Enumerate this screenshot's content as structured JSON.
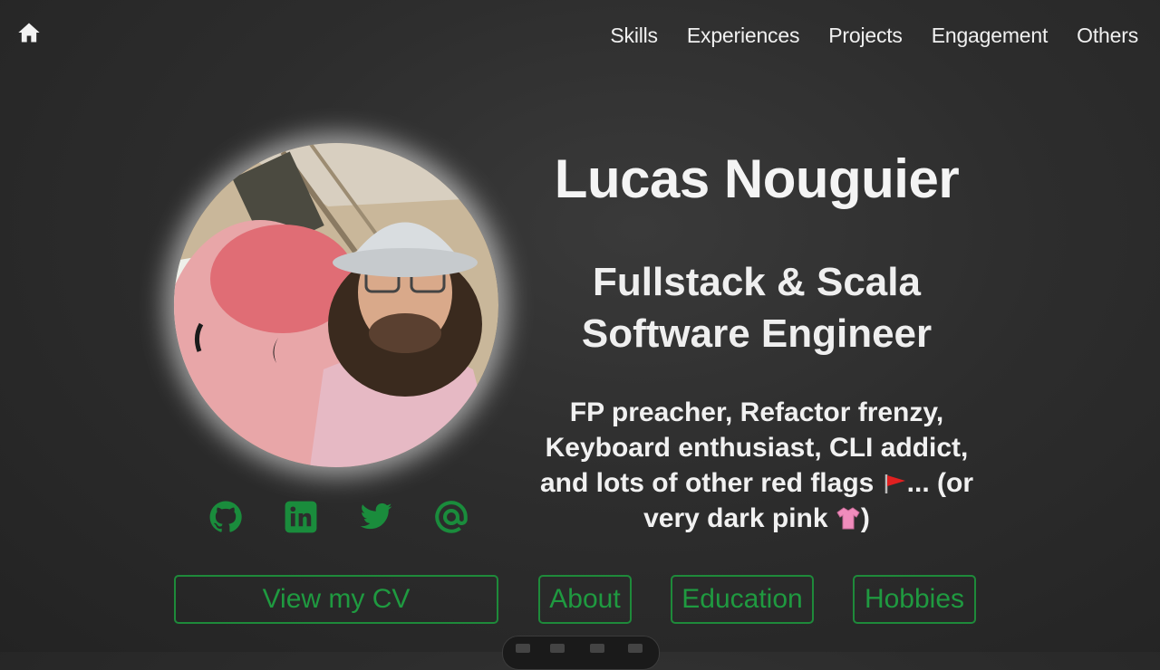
{
  "nav": {
    "home_icon": "home-icon",
    "items": [
      {
        "label": "Skills"
      },
      {
        "label": "Experiences"
      },
      {
        "label": "Projects"
      },
      {
        "label": "Engagement"
      },
      {
        "label": "Others"
      }
    ]
  },
  "profile": {
    "name": "Lucas Nouguier",
    "role_line1": "Fullstack & Scala",
    "role_line2": "Software Engineer",
    "tagline_part1": "FP preacher, Refactor frenzy, Keyboard enthusiast, CLI addict, and lots of other red flags ",
    "tagline_part2": "... (or very dark pink ",
    "tagline_part3": ")"
  },
  "socials": [
    {
      "icon": "github-icon"
    },
    {
      "icon": "linkedin-icon"
    },
    {
      "icon": "twitter-icon"
    },
    {
      "icon": "email-at-icon"
    }
  ],
  "buttons": {
    "cv": "View my CV",
    "about": "About",
    "education": "Education",
    "hobbies": "Hobbies"
  },
  "colors": {
    "accent_green": "#1f9a40",
    "background": "#2d2d2d",
    "text": "#f0f0f0"
  }
}
